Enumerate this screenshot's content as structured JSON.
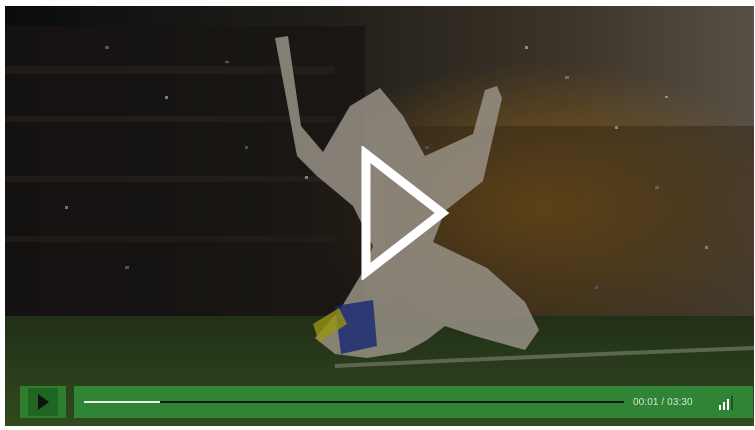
{
  "player": {
    "time_display": "00:01 / 03:30",
    "progress_fraction": 0.14,
    "volume_level": 3,
    "volume_level_max": 4
  },
  "colors": {
    "control_green": "#2f8535",
    "control_green_dark": "#1f6622",
    "play_icon_white": "#ffffff"
  },
  "icons": {
    "big_play": "play-icon",
    "small_play": "play-icon",
    "volume": "volume-bars-icon"
  }
}
